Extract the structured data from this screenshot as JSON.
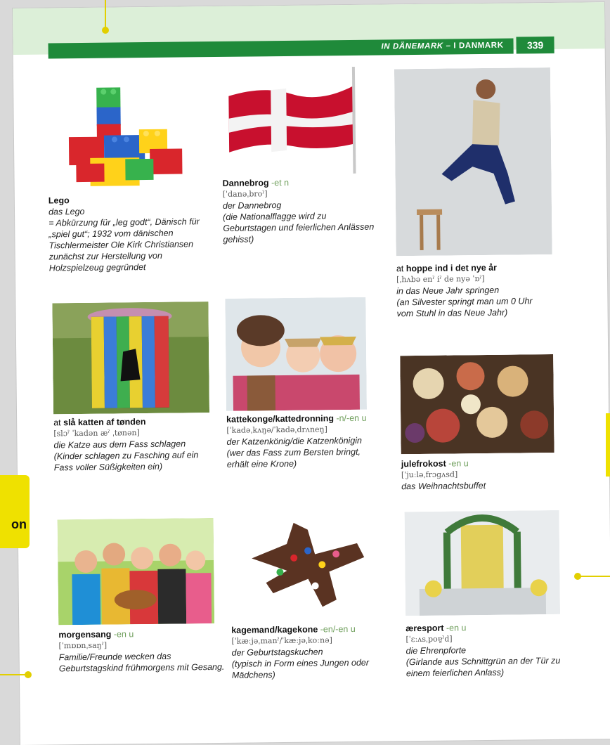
{
  "header": {
    "section_de": "IN DÄNEMARK",
    "separator": " – I ",
    "section_dk": "DANMARK",
    "page_number": "339"
  },
  "left_tab": {
    "label": "on"
  },
  "entries": [
    {
      "id": "lego",
      "term": "Lego",
      "prefix": "",
      "gram": "",
      "ipa": "",
      "translation": "das Lego",
      "note": "= Abkürzung für „leg godt“, Dänisch für „spiel gut“; 1932 vom dänischen Tischlermeister Ole Kirk Christiansen zunächst zur Herstellung von Holzspielzeug gegründet"
    },
    {
      "id": "dannebrog",
      "term": "Dannebrog",
      "prefix": "",
      "gram": " -et n",
      "ipa": "[ˈdanəˌbroˀ]",
      "translation": "der Dannebrog",
      "note": "(die Nationalflagge wird zu Geburtstagen und feierlichen Anlässen gehisst)"
    },
    {
      "id": "hoppe",
      "term": "hoppe ind i det nye år",
      "prefix": "at ",
      "gram": "",
      "ipa": "[ˌhʌbə enˀ iˀ de nyə ˈɒˀ]",
      "translation": "in das Neue Jahr springen",
      "note": "(an Silvester springt man um 0 Uhr vom Stuhl in das Neue Jahr)"
    },
    {
      "id": "slaa",
      "term": "slå katten af tønden",
      "prefix": "at ",
      "gram": "",
      "ipa": "[slɔˀ ˈkadən æˀ ˌtønən]",
      "translation": "die Katze aus dem Fass schlagen",
      "note": "(Kinder schlagen zu Fasching auf ein Fass voller Süßigkeiten ein)"
    },
    {
      "id": "kattekonge",
      "term": "kattekonge/kattedronning",
      "prefix": "",
      "gram": " -n/-en u",
      "ipa": "[ˈkadəˌkʌŋə/ˈkadəˌdrʌneŋ]",
      "translation": "der Katzenkönig/die Katzenkönigin",
      "note": "(wer das Fass zum Bersten bringt, erhält eine Krone)"
    },
    {
      "id": "julefrokost",
      "term": "julefrokost",
      "prefix": "",
      "gram": " -en u",
      "ipa": "[ˈjuːləˌfrɔɡʌsd]",
      "translation": "das Weihnachtsbuffet",
      "note": ""
    },
    {
      "id": "morgensang",
      "term": "morgensang",
      "prefix": "",
      "gram": " -en u",
      "ipa": "[ˈmɒɒnˌsaŋˀ]",
      "translation": "Familie/Freunde wecken das Geburtstagskind frühmorgens mit Gesang.",
      "note": ""
    },
    {
      "id": "kagemand",
      "term": "kagemand/kagekone",
      "prefix": "",
      "gram": " -en/-en u",
      "ipa": "[ˈkæːjəˌmanˀ/ˈkæːjəˌkoːnə]",
      "translation": "der Geburtstagskuchen",
      "note": "(typisch in Form eines Jungen oder Mädchens)"
    },
    {
      "id": "aeresport",
      "term": "æresport",
      "prefix": "",
      "gram": " -en u",
      "ipa": "[ˈɛːʌsˌpoɐ̯ˀd]",
      "translation": "die Ehrenpforte",
      "note": "(Girlande aus Schnittgrün an der Tür zu einem feierlichen Anlass)"
    }
  ],
  "colors": {
    "header_green": "#1f8a3a",
    "band_green": "#dcefd8",
    "accent_yellow": "#efe100",
    "gram_green": "#6f9f5c"
  }
}
